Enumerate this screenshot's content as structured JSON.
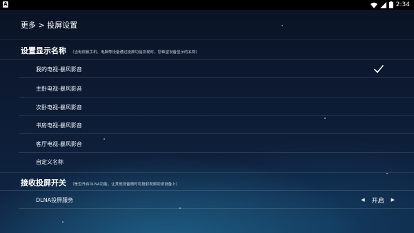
{
  "status_bar": {
    "time": "2:34",
    "icons": [
      "app-notification-icon",
      "wifi-icon",
      "signal-icon",
      "battery-icon"
    ],
    "app_badge": "A"
  },
  "header": {
    "breadcrumb": "更多 > 投屏设置"
  },
  "display_name_section": {
    "title": "设置显示名称",
    "description": "（当电视被手机、电脑等设备通过投屏功能发现时，您希望设备显示的名称）",
    "options": [
      {
        "label": "我的电视-暴风影音",
        "selected": true
      },
      {
        "label": "主卧电视-暴风影音",
        "selected": false
      },
      {
        "label": "次卧电视-暴风影音",
        "selected": false
      },
      {
        "label": "书房电视-暴风影音",
        "selected": false
      },
      {
        "label": "客厅电视-暴风影音",
        "selected": false
      },
      {
        "label": "自定义名称",
        "selected": false
      }
    ]
  },
  "receive_section": {
    "title": "接收投屏开关",
    "description": "（是否开启DLNA功能，让其他设备随时可投射视频到该设备上）",
    "dlna": {
      "label": "DLNA投屏服务",
      "value": "开启",
      "prev_icon": "arrow-left-icon",
      "next_icon": "arrow-right-icon"
    }
  },
  "colors": {
    "background_top": "#0a1324",
    "background_bottom": "#102746",
    "text": "#ffffff",
    "separator": "rgba(255,255,255,0.12)"
  }
}
